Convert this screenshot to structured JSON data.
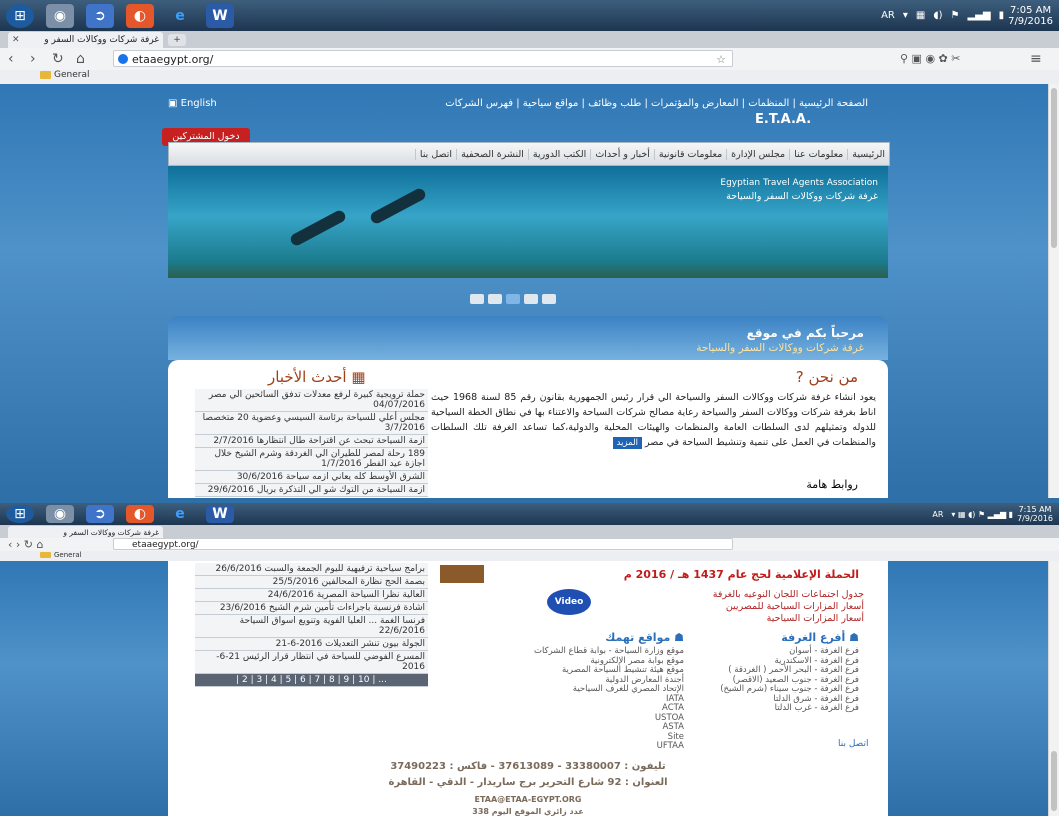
{
  "taskbar": {
    "time": "7:05 AM",
    "date": "7/9/2016",
    "lang": "AR"
  },
  "taskbar2": {
    "time": "7:15 AM",
    "date": "7/9/2016",
    "lang": "AR"
  },
  "browser": {
    "tab_title": "غرفة شركات ووكالات السفر و",
    "url": "etaaegypt.org/",
    "bookmark": "General"
  },
  "site": {
    "english_link": "English",
    "top_links": "الصفحة الرئيسية | المنظمات | المعارض والمؤتمرات | طلب وظائف | مواقع سياحية | فهرس الشركات",
    "logo": "E.T.A.A.",
    "org_en": "Egyptian Travel Agents Association",
    "org_ar": "غرفة شركات ووكالات السفر والسياحة",
    "login": "دخول المشتركين",
    "menu": [
      "الرئيسية",
      "معلومات عنا",
      "مجلس الإدارة",
      "معلومات قانونية",
      "أخبار و أحداث",
      "الكتب الدورية",
      "النشرة الصحفية",
      "اتصل بنا"
    ],
    "welcome1": "مرحباً بكم في موقع",
    "welcome2": "غرفة شركات ووكالات السفر والسياحة",
    "about_title": "من نحن",
    "about_text": "يعود انشاء غرفة شركات ووكالات السفر والسياحة الي قرار رئيس الجمهورية بقانون رقم 85 لسنة 1968 حيث اناط بغرفة شركات ووكالات السفر والسياحة رعاية مصالح شركات السياحة والاعتناء بها في نطاق الخطة السياحية للدوله وتمثيلهم لدى السلطات العامة والمنظمات والهيئات المحلية والدولية،كما تساعد الغرفة تلك السلطات والمنظمات في العمل على تنمية وتنشيط السياحة في مصر",
    "more": "المزيد",
    "links_title": "روابط هامة",
    "news_title": "أحدث الأخبار",
    "news": [
      "حملة ترويجية كبيرة لرفع معدلات تدفق السائحين الي مصر 04/07/2016",
      "مجلس أعلي للسياحة برئاسة السيسي وعضوية 20 متخصصا 3/7/2016",
      "ازمة السياحة تبحث عن اقتراحة طال انتظارها 2/7/2016",
      "189 رحلة لمصر للطيران الي الغردقة وشرم الشيخ خلال اجازة عيد الفطر 1/7/2016",
      "الشرق الأوسط كله يعاني ازمه سياحة 30/6/2016",
      "ازمة السياحة من التوك شو الي التذكرة بريال 29/6/2016"
    ]
  },
  "lower": {
    "hajj_title": "الحملة الإعلامية لحج عام 1437 هـ / 2016 م",
    "video": "Video",
    "links": [
      "جدول اجتماعات اللجان النوعيه بالغرفة",
      "أسعار المزارات السياحية للمصريين",
      "أسعار المزارات السياحية"
    ],
    "branches_title": "أفرع الغرفة",
    "branches": [
      "فرع الغرفة - أسوان",
      "فرع الغرفة - الاسكندرية",
      "فرع الغرفة - البحر الأحمر ( الغردقة )",
      "فرع الغرفة - جنوب الصعيد (الاقصر)",
      "فرع الغرفة - جنوب سيناء (شرم الشيخ)",
      "فرع الغرفة - شرق الدلتا",
      "فرع الغرفة - غرب الدلتا"
    ],
    "sites_title": "مواقع تهمك",
    "sites": [
      "موقع وزارة السياحة - بوابة قطاع الشركات",
      "موقع بوابة مصر الإلكترونية",
      "موقع هيئة تنشيط السياحة المصرية",
      "أجندة المعارض الدولية",
      "الإتحاد المصري للغرف السياحية",
      "IATA",
      "ACTA",
      "USTOA",
      "ASTA",
      "Site",
      "UFTAA"
    ],
    "news_tail": [
      "برامج سياحية ترفيهية لليوم الجمعة والسبت 26/6/2016",
      "بصمة الحج نظارة المحالفين 25/5/2016",
      "العالية نظرا السياحة المصرية 24/6/2016",
      "اشادة فرنسية باجراءات تأمين شرم الشيخ 23/6/2016",
      "فرنسا الغمة ... العليا الفوية وتنويع اسواق السياحة 22/6/2016",
      "الجولة بيون تنشر التعديلات 2016-6-21",
      "المسرع الفوضي للسياحة في انتظار قرار الرئيس 21-6-2016"
    ],
    "pages": "... | 10 | 9 | 8 | 7 | 6 | 5 | 4 | 3 | 2 |",
    "contact": "اتصل بنا",
    "phone": "تليفون : 33380007 - 37613089  -  فاكس : 37490223",
    "address": "العنوان : 92 شارع التحرير برج ساريدار - الدقي - القاهرة",
    "email": "ETAA@ETAA-EGYPT.ORG",
    "visitors": "عدد زائري الموقع اليوم  338"
  }
}
